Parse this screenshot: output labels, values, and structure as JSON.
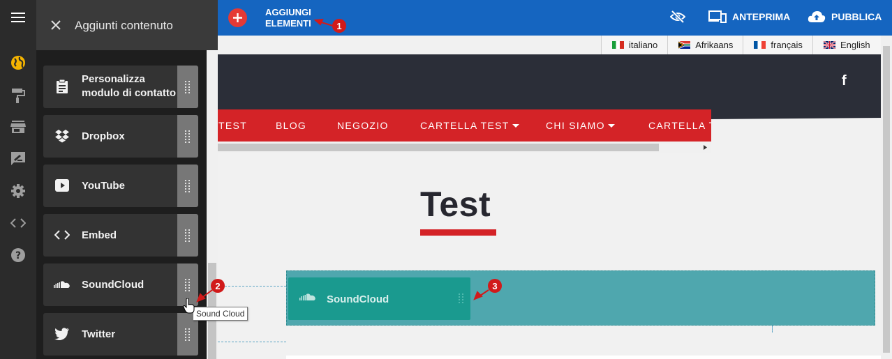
{
  "topbar": {
    "add_label_line1": "AGGIUNGI",
    "add_label_line2": "ELEMENTI",
    "preview_label": "ANTEPRIMA",
    "publish_label": "PUBBLICA",
    "icons": [
      "plus-icon",
      "eye-off-icon",
      "devices-icon",
      "cloud-upload-icon"
    ],
    "accent_color": "#1565c0"
  },
  "panel": {
    "title": "Aggiunti contenuto",
    "widgets": [
      {
        "label_line1": "Personalizza",
        "label_line2": "modulo di contatto",
        "icon": "clipboard-icon"
      },
      {
        "label": "Dropbox",
        "icon": "dropbox-icon"
      },
      {
        "label": "YouTube",
        "icon": "youtube-icon"
      },
      {
        "label": "Embed",
        "icon": "code-icon"
      },
      {
        "label": "SoundCloud",
        "icon": "soundcloud-icon"
      },
      {
        "label": "Twitter",
        "icon": "twitter-icon"
      }
    ]
  },
  "rail": {
    "icons": [
      "menu-icon",
      "globe-icon",
      "paint-roller-icon",
      "store-icon",
      "feedback-icon",
      "settings-icon",
      "code-icon",
      "help-icon"
    ]
  },
  "languages": [
    {
      "label": "italiano",
      "flag": "it"
    },
    {
      "label": "Afrikaans",
      "flag": "za"
    },
    {
      "label": "français",
      "flag": "fr"
    },
    {
      "label": "English",
      "flag": "gb"
    }
  ],
  "site": {
    "header_color": "#2b2e38",
    "nav_color": "#d42327",
    "facebook_glyph": "f",
    "nav": [
      {
        "label": "TEST"
      },
      {
        "label": "BLOG"
      },
      {
        "label": "NEGOZIO"
      },
      {
        "label": "CARTELLA TEST",
        "dropdown": true
      },
      {
        "label": "CHI SIAMO",
        "dropdown": true
      },
      {
        "label": "CARTELLA TEST"
      }
    ],
    "page_title": "Test"
  },
  "dropped_widget": {
    "label": "SoundCloud",
    "icon": "soundcloud-icon"
  },
  "tooltip": "Sound Cloud",
  "annotations": [
    "1",
    "2",
    "3"
  ]
}
